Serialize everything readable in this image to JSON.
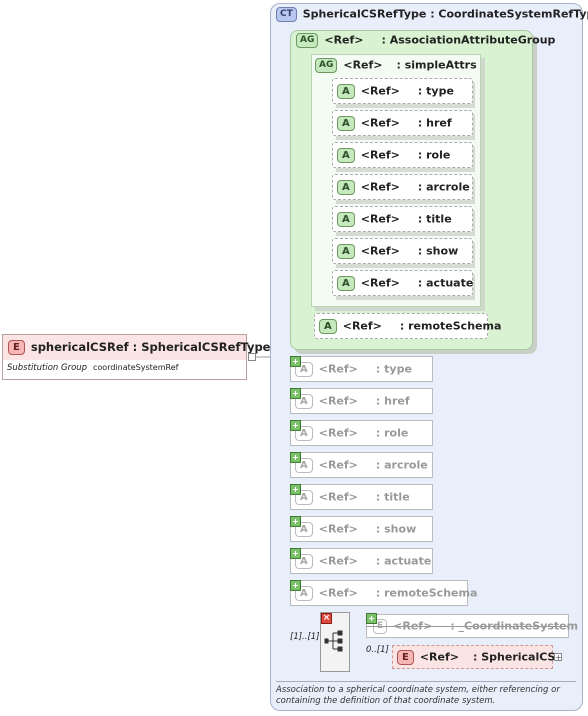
{
  "complex_type": {
    "badge": "CT",
    "label": "SphericalCSRefType : CoordinateSystemRefType"
  },
  "attribute_group": {
    "badge": "AG",
    "ref": "<Ref>",
    "name": ": AssociationAttributeGroup"
  },
  "inner_group": {
    "badge": "AG",
    "ref": "<Ref>",
    "name": ": simpleAttrs"
  },
  "inner_attributes": [
    {
      "badge": "A",
      "ref": "<Ref>",
      "name": ": type"
    },
    {
      "badge": "A",
      "ref": "<Ref>",
      "name": ": href"
    },
    {
      "badge": "A",
      "ref": "<Ref>",
      "name": ": role"
    },
    {
      "badge": "A",
      "ref": "<Ref>",
      "name": ": arcrole"
    },
    {
      "badge": "A",
      "ref": "<Ref>",
      "name": ": title"
    },
    {
      "badge": "A",
      "ref": "<Ref>",
      "name": ": show"
    },
    {
      "badge": "A",
      "ref": "<Ref>",
      "name": ": actuate"
    }
  ],
  "remote_schema": {
    "badge": "A",
    "ref": "<Ref>",
    "name": ": remoteSchema"
  },
  "collapsed_attributes": [
    {
      "badge": "A",
      "ref": "<Ref>",
      "name": ": type"
    },
    {
      "badge": "A",
      "ref": "<Ref>",
      "name": ": href"
    },
    {
      "badge": "A",
      "ref": "<Ref>",
      "name": ": role"
    },
    {
      "badge": "A",
      "ref": "<Ref>",
      "name": ": arcrole"
    },
    {
      "badge": "A",
      "ref": "<Ref>",
      "name": ": title"
    },
    {
      "badge": "A",
      "ref": "<Ref>",
      "name": ": show"
    },
    {
      "badge": "A",
      "ref": "<Ref>",
      "name": ": actuate"
    },
    {
      "badge": "A",
      "ref": "<Ref>",
      "name": ": remoteSchema"
    }
  ],
  "main_element": {
    "badge": "E",
    "label": "sphericalCSRef : SphericalCSRefType",
    "subst_label": "Substitution Group",
    "subst_value": "coordinateSystemRef"
  },
  "choice": {
    "multiplicity": "[1]..[1]"
  },
  "abstract_element": {
    "badge": "E",
    "ref": "<Ref>",
    "name": ": _CoordinateSystem"
  },
  "spherical_element": {
    "badge": "E",
    "ref": "<Ref>",
    "name": ": SphericalCS",
    "multiplicity": "0..[1]"
  },
  "documentation": "Association to a spherical coordinate system, either referencing or containing the definition of that coordinate system."
}
